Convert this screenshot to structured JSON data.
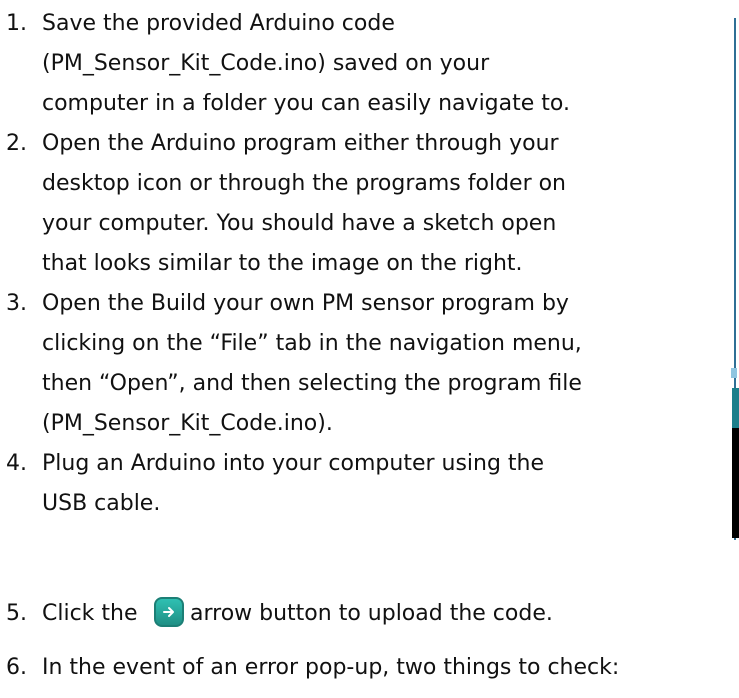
{
  "steps": [
    {
      "number": "1.",
      "lines": [
        "Save the provided Arduino code",
        "(PM_Sensor_Kit_Code.ino) saved on your",
        "computer in a folder you can easily navigate to."
      ]
    },
    {
      "number": "2.",
      "lines": [
        "Open the Arduino program either through your",
        "desktop icon or through the programs folder on",
        "your computer.  You should have a sketch open",
        "that looks similar to the image on the right."
      ]
    },
    {
      "number": "3.",
      "lines": [
        "Open the Build your own PM sensor program by",
        "clicking on the “File” tab in the navigation menu,",
        "then “Open”, and then selecting the program file",
        "(PM_Sensor_Kit_Code.ino)."
      ]
    },
    {
      "number": "4.",
      "lines": [
        "Plug an Arduino into your computer using the",
        "USB cable."
      ]
    },
    {
      "number": "5.",
      "before": "Click the",
      "after": "arrow button to upload the code."
    },
    {
      "number": "6.",
      "lines": [
        "In the event of an error pop-up, two things to check:"
      ]
    }
  ],
  "icons": {
    "upload": "upload-arrow-icon"
  },
  "colors": {
    "upload_icon": "#1f8f85",
    "text": "#111111",
    "frame": "#2f6f95"
  }
}
